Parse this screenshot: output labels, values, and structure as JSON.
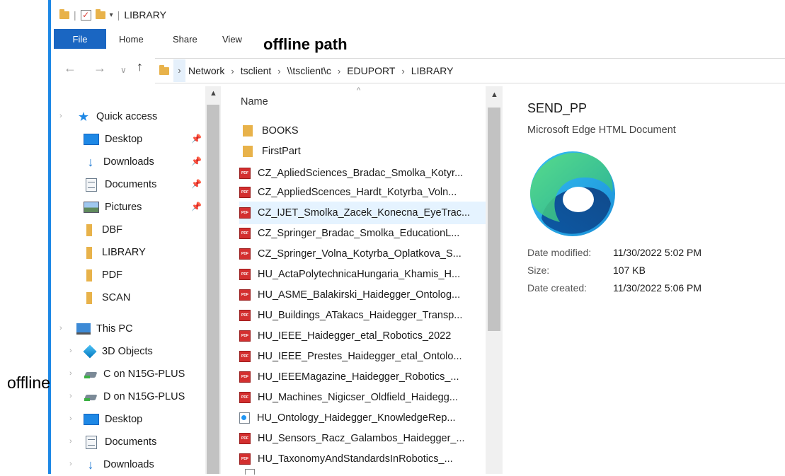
{
  "window": {
    "title": "LIBRARY"
  },
  "ribbon": {
    "tabs": [
      "File",
      "Home",
      "Share",
      "View"
    ]
  },
  "annotations": {
    "top": "offline path",
    "left": "offline"
  },
  "address": {
    "crumbs": [
      "Network",
      "tsclient",
      "\\\\tsclient\\c",
      "EDUPORT",
      "LIBRARY"
    ]
  },
  "nav": {
    "quick_access": "Quick access",
    "pinned": [
      "Desktop",
      "Downloads",
      "Documents",
      "Pictures"
    ],
    "folders": [
      "DBF",
      "LIBRARY",
      "PDF",
      "SCAN"
    ],
    "this_pc": "This PC",
    "pc_items": [
      "3D Objects",
      "C on N15G-PLUS",
      "D on N15G-PLUS",
      "Desktop",
      "Documents",
      "Downloads"
    ]
  },
  "list": {
    "column": "Name",
    "folders": [
      "BOOKS",
      "FirstPart"
    ],
    "files": [
      "CZ_ApliedSciences_Bradac_Smolka_Kotyr...",
      "CZ_AppliedScences_Hardt_Kotyrba_Voln...",
      "CZ_IJET_Smolka_Zacek_Konecna_EyeTrac...",
      "CZ_Springer_Bradac_Smolka_EducationL...",
      "CZ_Springer_Volna_Kotyrba_Oplatkova_S...",
      "HU_ActaPolytechnicaHungaria_Khamis_H...",
      "HU_ASME_Balakirski_Haidegger_Ontolog...",
      "HU_Buildings_ATakacs_Haidegger_Transp...",
      "HU_IEEE_Haidegger_etal_Robotics_2022",
      "HU_IEEE_Prestes_Haidegger_etal_Ontolo...",
      "HU_IEEEMagazine_Haidegger_Robotics_...",
      "HU_Machines_Nigicser_Oldfield_Haidegg...",
      "HU_Ontology_Haidegger_KnowledgeRep...",
      "HU_Sensors_Racz_Galambos_Haidegger_...",
      "HU_TaxonomyAndStandardsInRobotics_..."
    ]
  },
  "preview": {
    "name": "SEND_PP",
    "type": "Microsoft Edge HTML Document",
    "modified_label": "Date modified:",
    "modified_value": "11/30/2022 5:02 PM",
    "size_label": "Size:",
    "size_value": "107 KB",
    "created_label": "Date created:",
    "created_value": "11/30/2022 5:06 PM"
  }
}
